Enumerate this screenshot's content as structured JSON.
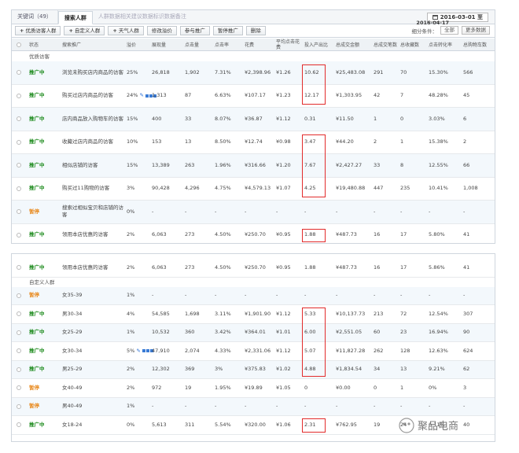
{
  "panel1": {
    "tabs": [
      "关键词（49）",
      "搜索人群",
      "人群数据相关建议数据标识数据备注"
    ],
    "date": "2016-03-01 至",
    "date2": "2016-04-17",
    "toolbar": {
      "buttons": [
        "优质访客人群",
        "自定义人群",
        "天气人群"
      ],
      "actions": [
        "修改溢价",
        "参与推广",
        "暂停推广",
        "删除"
      ],
      "filter_label": "细分条件：",
      "filter_value": "全部",
      "more_label": "更多数据"
    },
    "columns": [
      "状态",
      "搜索推广",
      "溢价",
      "展现量",
      "点击量",
      "点击率",
      "花费",
      "平均点击花费",
      "投入产出比",
      "总成交金额",
      "总成交笔数",
      "总收藏数",
      "点击转化率",
      "总购物车数"
    ],
    "group_label": "优质访客",
    "rows": [
      {
        "status": "推广中",
        "name": "浏览未购买店内商品的访客",
        "premium": "25%",
        "impressions": "26,818",
        "clicks": "1,902",
        "ctr": "7.31%",
        "cost": "¥2,398.96",
        "cpc": "¥1.26",
        "roi": "10.62",
        "gmv": "¥25,483.08",
        "orders": "291",
        "favorites": "70",
        "cvr": "15.30%",
        "carts": "566"
      },
      {
        "status": "推广中",
        "name": "购买过店内商品的访客",
        "premium": "24%",
        "impressions": "1,313",
        "clicks": "87",
        "ctr": "6.63%",
        "cost": "¥107.17",
        "cpc": "¥1.23",
        "roi": "12.17",
        "gmv": "¥1,303.95",
        "orders": "42",
        "favorites": "7",
        "cvr": "48.28%",
        "carts": "45"
      },
      {
        "status": "推广中",
        "name": "店内商品放入购物车的访客",
        "premium": "15%",
        "impressions": "400",
        "clicks": "33",
        "ctr": "8.07%",
        "cost": "¥36.87",
        "cpc": "¥1.12",
        "roi": "0.31",
        "gmv": "¥11.50",
        "orders": "1",
        "favorites": "0",
        "cvr": "3.03%",
        "carts": "6"
      },
      {
        "status": "推广中",
        "name": "收藏过店内商品的访客",
        "premium": "10%",
        "impressions": "153",
        "clicks": "13",
        "ctr": "8.50%",
        "cost": "¥12.74",
        "cpc": "¥0.98",
        "roi": "3.47",
        "gmv": "¥44.20",
        "orders": "2",
        "favorites": "1",
        "cvr": "15.38%",
        "carts": "2"
      },
      {
        "status": "推广中",
        "name": "相似店铺的访客",
        "premium": "15%",
        "impressions": "13,389",
        "clicks": "263",
        "ctr": "1.96%",
        "cost": "¥316.66",
        "cpc": "¥1.20",
        "roi": "7.67",
        "gmv": "¥2,427.27",
        "orders": "33",
        "favorites": "8",
        "cvr": "12.55%",
        "carts": "66"
      },
      {
        "status": "推广中",
        "name": "购买过11购物的访客",
        "premium": "3%",
        "impressions": "90,428",
        "clicks": "4,296",
        "ctr": "4.75%",
        "cost": "¥4,579.13",
        "cpc": "¥1.07",
        "roi": "4.25",
        "gmv": "¥19,480.88",
        "orders": "447",
        "favorites": "235",
        "cvr": "10.41%",
        "carts": "1,008"
      },
      {
        "status": "暂停",
        "name": "搜索过相似宝贝和店铺的访客",
        "premium": "0%",
        "impressions": "-",
        "clicks": "-",
        "ctr": "-",
        "cost": "-",
        "cpc": "-",
        "roi": "-",
        "gmv": "-",
        "orders": "-",
        "favorites": "-",
        "cvr": "-",
        "carts": "-"
      },
      {
        "status": "推广中",
        "name": "领用本店优惠的访客",
        "premium": "2%",
        "impressions": "6,063",
        "clicks": "273",
        "ctr": "4.50%",
        "cost": "¥250.70",
        "cpc": "¥0.95",
        "roi": "1.88",
        "gmv": "¥487.73",
        "orders": "16",
        "favorites": "17",
        "cvr": "5.80%",
        "carts": "41"
      }
    ]
  },
  "panel2": {
    "first_row": {
      "status": "推广中",
      "name": "领用本店优惠的访客",
      "premium": "2%",
      "impressions": "6,063",
      "clicks": "273",
      "ctr": "4.50%",
      "cost": "¥250.70",
      "cpc": "¥0.95",
      "roi": "1.88",
      "gmv": "¥487.73",
      "orders": "16",
      "favorites": "17",
      "cvr": "5.86%",
      "carts": "41"
    },
    "group_label": "自定义人群",
    "rows": [
      {
        "status": "暂停",
        "name": "女35-39",
        "premium": "1%",
        "impressions": "-",
        "clicks": "-",
        "ctr": "-",
        "cost": "-",
        "cpc": "-",
        "roi": "-",
        "gmv": "-",
        "orders": "-",
        "favorites": "-",
        "cvr": "-",
        "carts": "-"
      },
      {
        "status": "推广中",
        "name": "男30-34",
        "premium": "4%",
        "impressions": "54,585",
        "clicks": "1,698",
        "ctr": "3.11%",
        "cost": "¥1,901.90",
        "cpc": "¥1.12",
        "roi": "5.33",
        "gmv": "¥10,137.73",
        "orders": "213",
        "favorites": "72",
        "cvr": "12.54%",
        "carts": "307"
      },
      {
        "status": "推广中",
        "name": "女25-29",
        "premium": "1%",
        "impressions": "10,532",
        "clicks": "360",
        "ctr": "3.42%",
        "cost": "¥364.01",
        "cpc": "¥1.01",
        "roi": "6.00",
        "gmv": "¥2,551.05",
        "orders": "60",
        "favorites": "23",
        "cvr": "16.94%",
        "carts": "90"
      },
      {
        "status": "推广中",
        "name": "女30-34",
        "premium": "5%",
        "impressions": "47,910",
        "clicks": "2,074",
        "ctr": "4.33%",
        "cost": "¥2,331.06",
        "cpc": "¥1.12",
        "roi": "5.07",
        "gmv": "¥11,827.28",
        "orders": "262",
        "favorites": "128",
        "cvr": "12.63%",
        "carts": "624"
      },
      {
        "status": "推广中",
        "name": "男25-29",
        "premium": "2%",
        "impressions": "12,302",
        "clicks": "369",
        "ctr": "3%",
        "cost": "¥375.83",
        "cpc": "¥1.02",
        "roi": "4.88",
        "gmv": "¥1,834.54",
        "orders": "34",
        "favorites": "13",
        "cvr": "9.21%",
        "carts": "62"
      },
      {
        "status": "暂停",
        "name": "女40-49",
        "premium": "2%",
        "impressions": "972",
        "clicks": "19",
        "ctr": "1.95%",
        "cost": "¥19.89",
        "cpc": "¥1.05",
        "roi": "0",
        "gmv": "¥0.00",
        "orders": "0",
        "favorites": "1",
        "cvr": "0%",
        "carts": "3"
      },
      {
        "status": "暂停",
        "name": "男40-49",
        "premium": "1%",
        "impressions": "-",
        "clicks": "-",
        "ctr": "-",
        "cost": "-",
        "cpc": "-",
        "roi": "-",
        "gmv": "-",
        "orders": "-",
        "favorites": "-",
        "cvr": "-",
        "carts": "-"
      },
      {
        "status": "推广中",
        "name": "女18-24",
        "premium": "0%",
        "impressions": "5,613",
        "clicks": "311",
        "ctr": "5.54%",
        "cost": "¥320.00",
        "cpc": "¥1.06",
        "roi": "2.31",
        "gmv": "¥762.95",
        "orders": "19",
        "favorites": "24",
        "cvr": "6.11%",
        "carts": "40"
      }
    ]
  },
  "watermark": "聚品电商",
  "colors": {
    "on": "#1c8a1c",
    "pause": "#e8891d",
    "highlight": "#e22b2b"
  }
}
